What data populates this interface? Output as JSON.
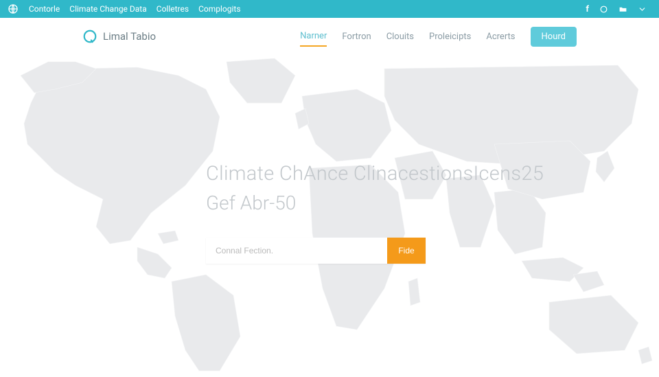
{
  "topbar": {
    "links": [
      "Contorle",
      "Climate Change Data",
      "Colletres",
      "Complogits"
    ]
  },
  "brand": {
    "name": "Limal Tabio"
  },
  "nav": {
    "items": [
      {
        "label": "Narner",
        "active": true
      },
      {
        "label": "Fortron",
        "active": false
      },
      {
        "label": "Clouits",
        "active": false
      },
      {
        "label": "Proleicipts",
        "active": false
      },
      {
        "label": "Acrerts",
        "active": false
      }
    ],
    "cta": "Hourd"
  },
  "hero": {
    "title": "Climate ChAnce ClinacestionsIcens25",
    "subtitle": "Gef Abr-50",
    "search_placeholder": "Connal Fection.",
    "search_button": "Fide"
  },
  "colors": {
    "primary": "#30b8c9",
    "accent": "#f49a1a",
    "nav_active_underline": "#f5a623"
  }
}
